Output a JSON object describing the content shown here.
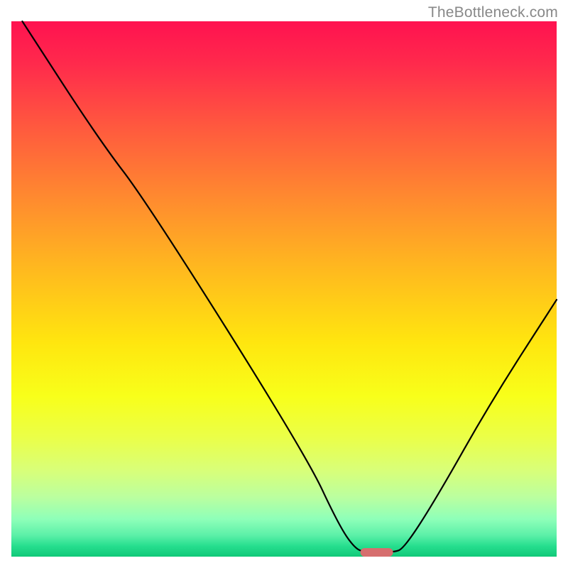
{
  "watermark": {
    "text": "TheBottleneck.com"
  },
  "colors": {
    "curve": "#000000",
    "pill": "#d66e6e",
    "gradient_top": "#ff1250",
    "gradient_mid": "#ffe60f",
    "gradient_bottom": "#10c878"
  },
  "chart_data": {
    "type": "line",
    "title": "",
    "xlabel": "",
    "ylabel": "",
    "x_range": [
      0,
      100
    ],
    "y_range": [
      0,
      100
    ],
    "curve_points": [
      {
        "x": 2.0,
        "y": 100.0
      },
      {
        "x": 16.0,
        "y": 78.0
      },
      {
        "x": 25.0,
        "y": 66.0
      },
      {
        "x": 54.0,
        "y": 19.0
      },
      {
        "x": 60.0,
        "y": 6.0
      },
      {
        "x": 63.0,
        "y": 1.5
      },
      {
        "x": 65.0,
        "y": 0.8
      },
      {
        "x": 70.0,
        "y": 0.8
      },
      {
        "x": 72.0,
        "y": 1.5
      },
      {
        "x": 78.0,
        "y": 11.0
      },
      {
        "x": 88.0,
        "y": 29.0
      },
      {
        "x": 100.0,
        "y": 48.0
      }
    ],
    "optimum_marker": {
      "x_start": 64.0,
      "x_end": 70.0,
      "y": 0.8
    },
    "notes": "Bottleneck-style V-curve over red-to-green vertical gradient. Minimum (optimal point) near x≈67%. Values estimated from pixel positions; no axis ticks or numeric labels are present in the image."
  }
}
